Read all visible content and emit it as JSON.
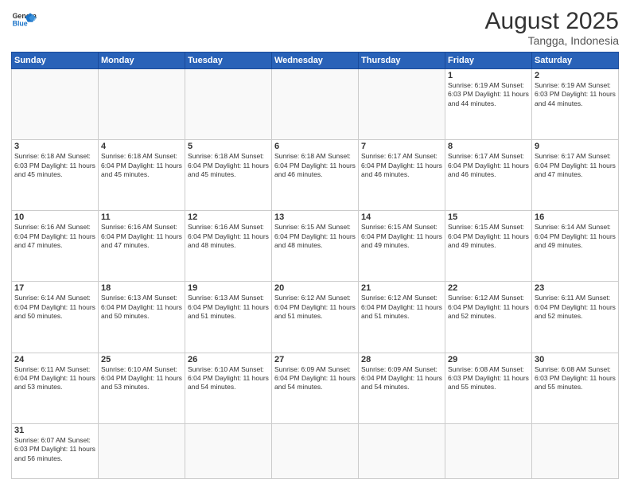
{
  "header": {
    "logo_general": "General",
    "logo_blue": "Blue",
    "month_year": "August 2025",
    "location": "Tangga, Indonesia"
  },
  "weekdays": [
    "Sunday",
    "Monday",
    "Tuesday",
    "Wednesday",
    "Thursday",
    "Friday",
    "Saturday"
  ],
  "weeks": [
    [
      {
        "day": "",
        "info": ""
      },
      {
        "day": "",
        "info": ""
      },
      {
        "day": "",
        "info": ""
      },
      {
        "day": "",
        "info": ""
      },
      {
        "day": "",
        "info": ""
      },
      {
        "day": "1",
        "info": "Sunrise: 6:19 AM\nSunset: 6:03 PM\nDaylight: 11 hours\nand 44 minutes."
      },
      {
        "day": "2",
        "info": "Sunrise: 6:19 AM\nSunset: 6:03 PM\nDaylight: 11 hours\nand 44 minutes."
      }
    ],
    [
      {
        "day": "3",
        "info": "Sunrise: 6:18 AM\nSunset: 6:03 PM\nDaylight: 11 hours\nand 45 minutes."
      },
      {
        "day": "4",
        "info": "Sunrise: 6:18 AM\nSunset: 6:04 PM\nDaylight: 11 hours\nand 45 minutes."
      },
      {
        "day": "5",
        "info": "Sunrise: 6:18 AM\nSunset: 6:04 PM\nDaylight: 11 hours\nand 45 minutes."
      },
      {
        "day": "6",
        "info": "Sunrise: 6:18 AM\nSunset: 6:04 PM\nDaylight: 11 hours\nand 46 minutes."
      },
      {
        "day": "7",
        "info": "Sunrise: 6:17 AM\nSunset: 6:04 PM\nDaylight: 11 hours\nand 46 minutes."
      },
      {
        "day": "8",
        "info": "Sunrise: 6:17 AM\nSunset: 6:04 PM\nDaylight: 11 hours\nand 46 minutes."
      },
      {
        "day": "9",
        "info": "Sunrise: 6:17 AM\nSunset: 6:04 PM\nDaylight: 11 hours\nand 47 minutes."
      }
    ],
    [
      {
        "day": "10",
        "info": "Sunrise: 6:16 AM\nSunset: 6:04 PM\nDaylight: 11 hours\nand 47 minutes."
      },
      {
        "day": "11",
        "info": "Sunrise: 6:16 AM\nSunset: 6:04 PM\nDaylight: 11 hours\nand 47 minutes."
      },
      {
        "day": "12",
        "info": "Sunrise: 6:16 AM\nSunset: 6:04 PM\nDaylight: 11 hours\nand 48 minutes."
      },
      {
        "day": "13",
        "info": "Sunrise: 6:15 AM\nSunset: 6:04 PM\nDaylight: 11 hours\nand 48 minutes."
      },
      {
        "day": "14",
        "info": "Sunrise: 6:15 AM\nSunset: 6:04 PM\nDaylight: 11 hours\nand 49 minutes."
      },
      {
        "day": "15",
        "info": "Sunrise: 6:15 AM\nSunset: 6:04 PM\nDaylight: 11 hours\nand 49 minutes."
      },
      {
        "day": "16",
        "info": "Sunrise: 6:14 AM\nSunset: 6:04 PM\nDaylight: 11 hours\nand 49 minutes."
      }
    ],
    [
      {
        "day": "17",
        "info": "Sunrise: 6:14 AM\nSunset: 6:04 PM\nDaylight: 11 hours\nand 50 minutes."
      },
      {
        "day": "18",
        "info": "Sunrise: 6:13 AM\nSunset: 6:04 PM\nDaylight: 11 hours\nand 50 minutes."
      },
      {
        "day": "19",
        "info": "Sunrise: 6:13 AM\nSunset: 6:04 PM\nDaylight: 11 hours\nand 51 minutes."
      },
      {
        "day": "20",
        "info": "Sunrise: 6:12 AM\nSunset: 6:04 PM\nDaylight: 11 hours\nand 51 minutes."
      },
      {
        "day": "21",
        "info": "Sunrise: 6:12 AM\nSunset: 6:04 PM\nDaylight: 11 hours\nand 51 minutes."
      },
      {
        "day": "22",
        "info": "Sunrise: 6:12 AM\nSunset: 6:04 PM\nDaylight: 11 hours\nand 52 minutes."
      },
      {
        "day": "23",
        "info": "Sunrise: 6:11 AM\nSunset: 6:04 PM\nDaylight: 11 hours\nand 52 minutes."
      }
    ],
    [
      {
        "day": "24",
        "info": "Sunrise: 6:11 AM\nSunset: 6:04 PM\nDaylight: 11 hours\nand 53 minutes."
      },
      {
        "day": "25",
        "info": "Sunrise: 6:10 AM\nSunset: 6:04 PM\nDaylight: 11 hours\nand 53 minutes."
      },
      {
        "day": "26",
        "info": "Sunrise: 6:10 AM\nSunset: 6:04 PM\nDaylight: 11 hours\nand 54 minutes."
      },
      {
        "day": "27",
        "info": "Sunrise: 6:09 AM\nSunset: 6:04 PM\nDaylight: 11 hours\nand 54 minutes."
      },
      {
        "day": "28",
        "info": "Sunrise: 6:09 AM\nSunset: 6:04 PM\nDaylight: 11 hours\nand 54 minutes."
      },
      {
        "day": "29",
        "info": "Sunrise: 6:08 AM\nSunset: 6:03 PM\nDaylight: 11 hours\nand 55 minutes."
      },
      {
        "day": "30",
        "info": "Sunrise: 6:08 AM\nSunset: 6:03 PM\nDaylight: 11 hours\nand 55 minutes."
      }
    ],
    [
      {
        "day": "31",
        "info": "Sunrise: 6:07 AM\nSunset: 6:03 PM\nDaylight: 11 hours\nand 56 minutes."
      },
      {
        "day": "",
        "info": ""
      },
      {
        "day": "",
        "info": ""
      },
      {
        "day": "",
        "info": ""
      },
      {
        "day": "",
        "info": ""
      },
      {
        "day": "",
        "info": ""
      },
      {
        "day": "",
        "info": ""
      }
    ]
  ]
}
